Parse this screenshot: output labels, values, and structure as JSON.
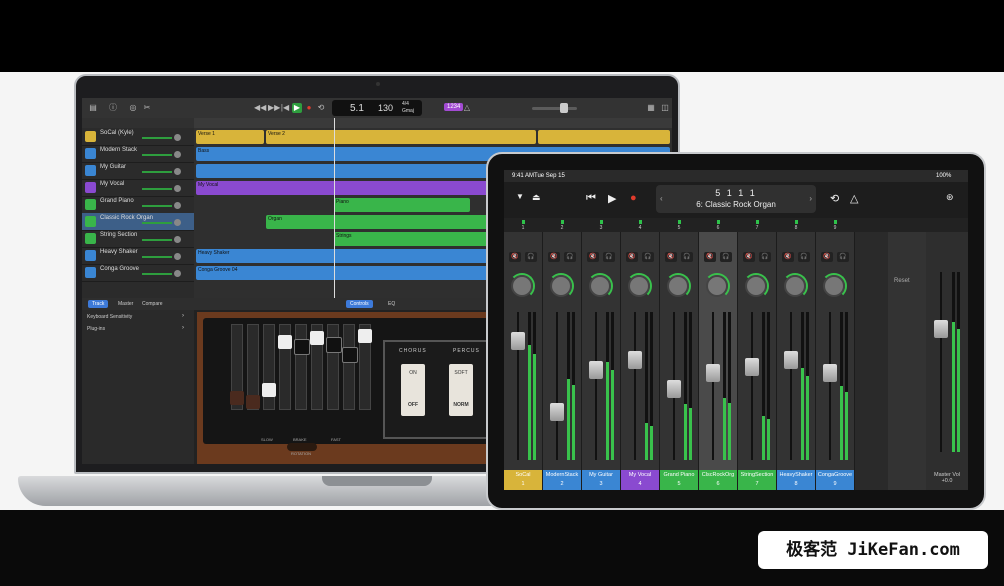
{
  "colors": {
    "yellow": "#d8b43a",
    "blue": "#3a86d3",
    "purple": "#8a4ad0",
    "green": "#39b54a",
    "accent_green": "#39c24c",
    "record": "#e03b2c"
  },
  "mac": {
    "lcd": {
      "bar": "5.1",
      "tempo": "130",
      "time_sig": "4/4",
      "key": "Gmaj"
    },
    "count_in": "1234",
    "tracks": [
      {
        "name": "SoCal (Kyle)",
        "color": "#d8b43a",
        "icon": "drum-icon"
      },
      {
        "name": "Modern Stack",
        "color": "#3a86d3",
        "icon": "bass-guitar-icon"
      },
      {
        "name": "My Guitar",
        "color": "#3a86d3",
        "icon": "guitar-icon"
      },
      {
        "name": "My Vocal",
        "color": "#8a4ad0",
        "icon": "microphone-icon"
      },
      {
        "name": "Grand Piano",
        "color": "#39b54a",
        "icon": "piano-icon"
      },
      {
        "name": "Classic Rock Organ",
        "color": "#39b54a",
        "icon": "organ-icon"
      },
      {
        "name": "String Section",
        "color": "#39b54a",
        "icon": "violin-icon"
      },
      {
        "name": "Heavy Shaker",
        "color": "#3a86d3",
        "icon": "shaker-icon"
      },
      {
        "name": "Conga Groove",
        "color": "#3a86d3",
        "icon": "conga-icon"
      }
    ],
    "regions": {
      "verse1": "Verse 1",
      "verse2": "Verse 2",
      "bass": "Bass",
      "my_vocal": "My Vocal",
      "piano": "Piano",
      "organ": "Organ",
      "strings": "Strings",
      "heavy_shaker": "Heavy Shaker",
      "conga": "Conga Groove 04"
    },
    "editor": {
      "tabs": [
        "Track",
        "Master",
        "Compare"
      ],
      "right_tabs": [
        "Controls",
        "EQ"
      ],
      "left_rows": [
        "Keyboard Sensitivity",
        "Plug-ins"
      ],
      "chorus_label": "CHORUS",
      "percussion_label": "PERCUS",
      "on": "ON",
      "off": "OFF",
      "soft": "SOFT",
      "norm": "NORM",
      "slow": "SLOW",
      "brake": "BRAKE",
      "fast": "FAST",
      "rotation": "ROTATION"
    }
  },
  "ipad": {
    "status": {
      "time": "9:41 AM",
      "date": "Tue Sep 15",
      "battery": "100%"
    },
    "lcd": {
      "position": "5  1  1     1",
      "name": "6: Classic Rock Organ"
    },
    "channel_numbers": [
      "1",
      "2",
      "3",
      "4",
      "5",
      "6",
      "7",
      "8",
      "9"
    ],
    "channels": [
      {
        "name": "SoCal",
        "num": "1",
        "color": "#d8b43a",
        "level": 0.78
      },
      {
        "name": "ModernStack",
        "num": "2",
        "color": "#3a86d3",
        "level": 0.55
      },
      {
        "name": "My Guitar",
        "num": "3",
        "color": "#3a86d3",
        "level": 0.66
      },
      {
        "name": "My Vocal",
        "num": "4",
        "color": "#8a4ad0",
        "level": 0.25
      },
      {
        "name": "Grand Piano",
        "num": "5",
        "color": "#39b54a",
        "level": 0.38
      },
      {
        "name": "ClscRockOrg",
        "num": "6",
        "color": "#39b54a",
        "level": 0.42
      },
      {
        "name": "StringSection",
        "num": "7",
        "color": "#39b54a",
        "level": 0.3
      },
      {
        "name": "HeavyShaker",
        "num": "8",
        "color": "#3a86d3",
        "level": 0.62
      },
      {
        "name": "CongaGroove",
        "num": "9",
        "color": "#3a86d3",
        "level": 0.5
      }
    ],
    "fader_levels": [
      0.85,
      0.3,
      0.62,
      0.7,
      0.48,
      0.6,
      0.65,
      0.7,
      0.6
    ],
    "reset_label": "Reset",
    "master": {
      "label": "Master Vol",
      "value": "+0.0",
      "level": 0.72
    }
  },
  "watermark": "极客范 JiKeFan.com"
}
